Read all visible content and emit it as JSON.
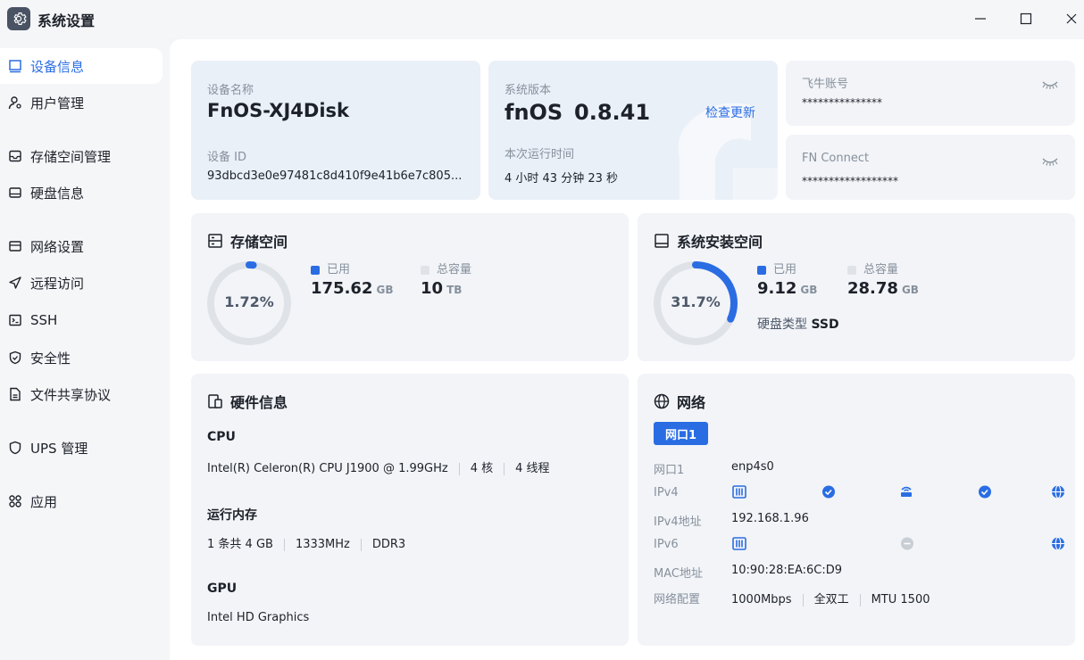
{
  "window": {
    "title": "系统设置",
    "controls": [
      "minimize",
      "maximize",
      "close"
    ]
  },
  "sidebar": {
    "items": [
      {
        "label": "设备信息",
        "icon": "monitor-icon",
        "active": true
      },
      {
        "label": "用户管理",
        "icon": "user-gear-icon"
      },
      {
        "label": "存储空间管理",
        "icon": "storage-icon"
      },
      {
        "label": "硬盘信息",
        "icon": "disk-icon"
      },
      {
        "label": "网络设置",
        "icon": "network-icon"
      },
      {
        "label": "远程访问",
        "icon": "send-icon"
      },
      {
        "label": "SSH",
        "icon": "terminal-icon"
      },
      {
        "label": "安全性",
        "icon": "shield-check-icon"
      },
      {
        "label": "文件共享协议",
        "icon": "file-icon"
      },
      {
        "label": "UPS 管理",
        "icon": "shield-icon"
      },
      {
        "label": "应用",
        "icon": "apps-icon"
      }
    ]
  },
  "device": {
    "name_label": "设备名称",
    "name": "FnOS-XJ4Disk",
    "id_label": "设备 ID",
    "id": "93dbcd3e0e97481c8d410f9e41b6e7c805..."
  },
  "system": {
    "version_label": "系统版本",
    "os": "fnOS",
    "version": "0.8.41",
    "check_update": "检查更新",
    "uptime_label": "本次运行时间",
    "uptime": "4 小时 43 分钟 23 秒"
  },
  "accounts": {
    "feiniu_label": "飞牛账号",
    "feiniu_value": "***************",
    "fnconnect_label": "FN Connect",
    "fnconnect_value": "******************",
    "toggle_icon": "eye-closed-icon"
  },
  "storage": {
    "title": "存储空间",
    "percent_text": "1.72%",
    "percent": 1.72,
    "used_label": "已用",
    "used_value": "175.62",
    "used_unit": "GB",
    "total_label": "总容量",
    "total_value": "10",
    "total_unit": "TB"
  },
  "system_space": {
    "title": "系统安装空间",
    "percent_text": "31.7%",
    "percent": 31.7,
    "used_label": "已用",
    "used_value": "9.12",
    "used_unit": "GB",
    "total_label": "总容量",
    "total_value": "28.78",
    "total_unit": "GB",
    "disk_type_label": "硬盘类型",
    "disk_type": "SSD"
  },
  "hardware": {
    "title": "硬件信息",
    "cpu_label": "CPU",
    "cpu_model": "Intel(R) Celeron(R) CPU J1900 @ 1.99GHz",
    "cpu_cores": "4 核",
    "cpu_threads": "4 线程",
    "mem_label": "运行内存",
    "mem_modules": "1 条共 4 GB",
    "mem_speed": "1333MHz",
    "mem_type": "DDR3",
    "gpu_label": "GPU",
    "gpu_model": "Intel HD Graphics"
  },
  "network": {
    "title": "网络",
    "tab": "网口1",
    "rows": {
      "port_label": "网口1",
      "port_value": "enp4s0",
      "ipv4_label": "IPv4",
      "ipv4_addr_label": "IPv4地址",
      "ipv4_addr": "192.168.1.96",
      "ipv6_label": "IPv6",
      "mac_label": "MAC地址",
      "mac": "10:90:28:EA:6C:D9",
      "config_label": "网络配置",
      "speed": "1000Mbps",
      "duplex": "全双工",
      "mtu": "MTU 1500"
    },
    "ipv4_status": [
      "connected",
      "connected"
    ],
    "ipv6_status": [
      "disconnected"
    ]
  },
  "colors": {
    "accent": "#2a6de3",
    "ring_track": "#dfe3e8",
    "legend_total": "#dfe3e8"
  }
}
